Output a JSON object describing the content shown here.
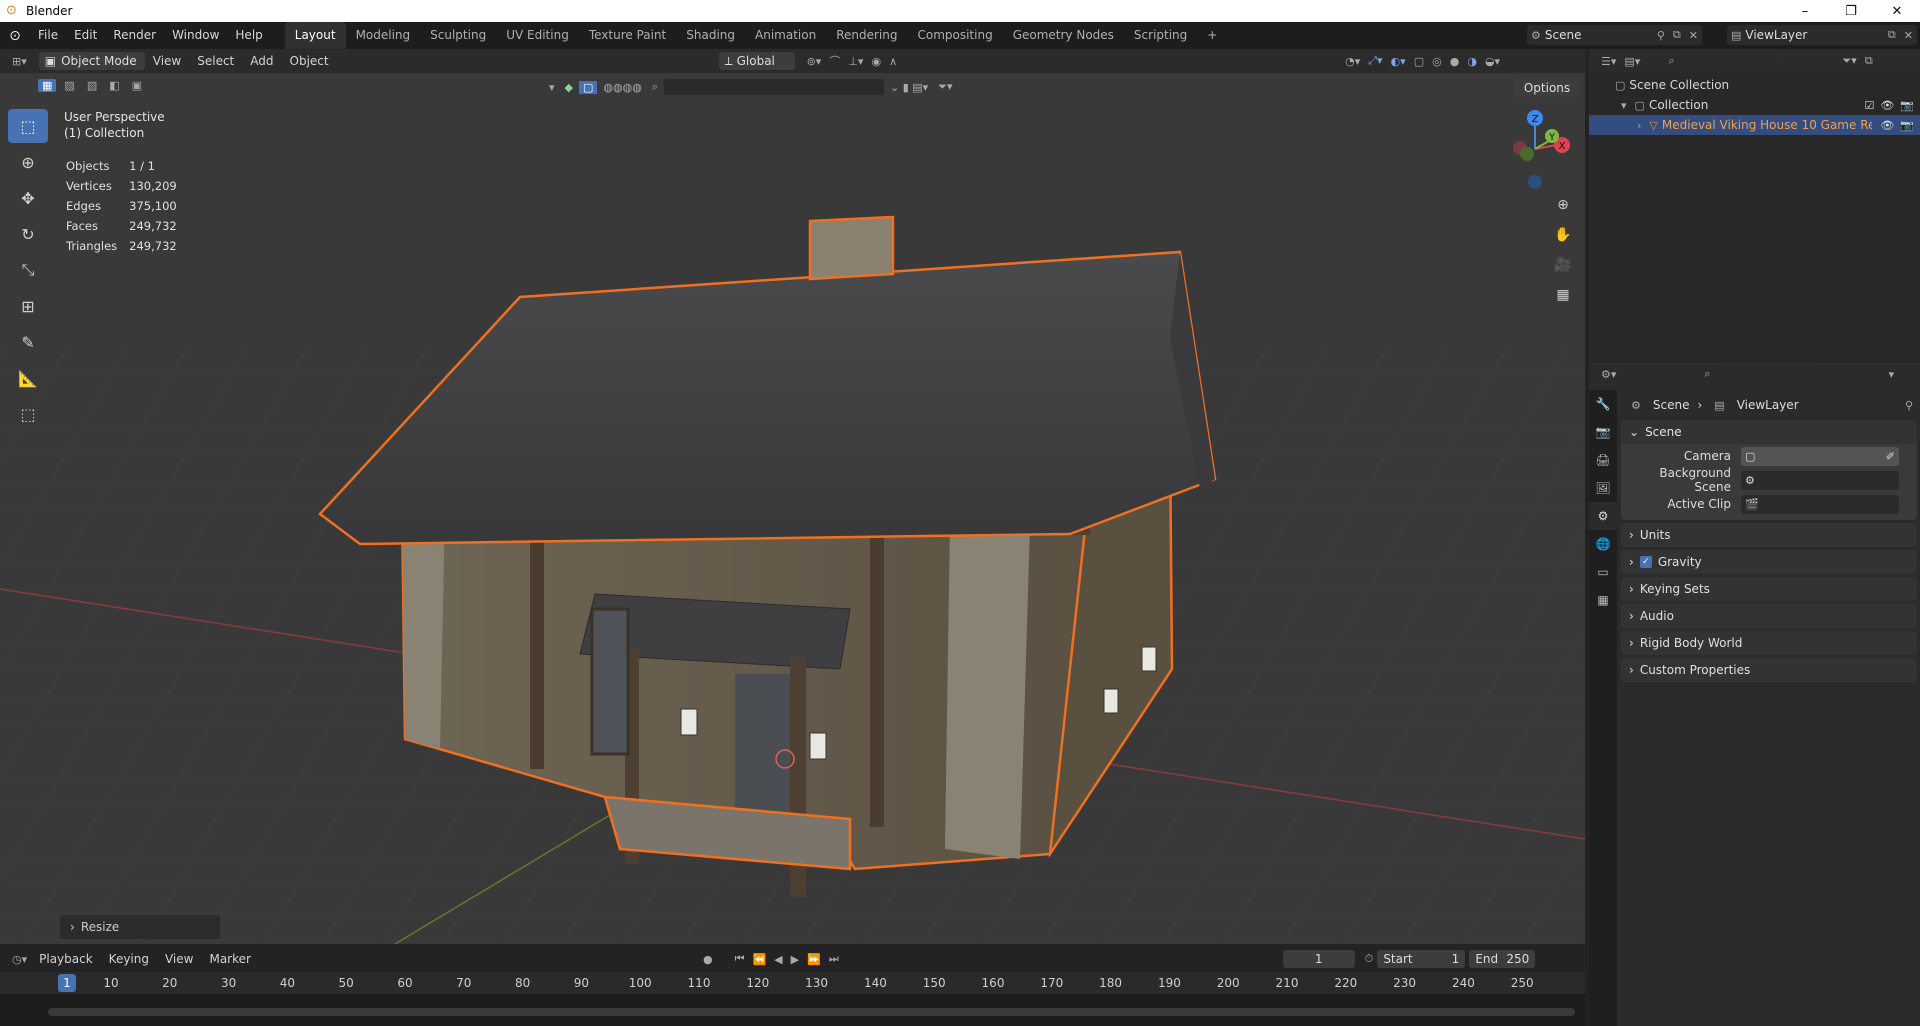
{
  "window": {
    "title": "Blender",
    "controls": [
      "–",
      "❐",
      "✕"
    ]
  },
  "topbar": {
    "menus": [
      "File",
      "Edit",
      "Render",
      "Window",
      "Help"
    ],
    "workspaces": [
      "Layout",
      "Modeling",
      "Sculpting",
      "UV Editing",
      "Texture Paint",
      "Shading",
      "Animation",
      "Rendering",
      "Compositing",
      "Geometry Nodes",
      "Scripting"
    ],
    "add_tab": "+",
    "scene_name": "Scene",
    "view_layer": "ViewLayer"
  },
  "viewport": {
    "mode": "Object Mode",
    "menus": [
      "View",
      "Select",
      "Add",
      "Object"
    ],
    "orientation": "Global",
    "options_label": "Options",
    "perspective": "User Perspective",
    "collection": "(1) Collection",
    "stats": [
      {
        "label": "Objects",
        "value": "1 / 1"
      },
      {
        "label": "Vertices",
        "value": "130,209"
      },
      {
        "label": "Edges",
        "value": "375,100"
      },
      {
        "label": "Faces",
        "value": "249,732"
      },
      {
        "label": "Triangles",
        "value": "249,732"
      }
    ],
    "last_op": "Resize",
    "gizmo_axes": {
      "z": "Z",
      "y": "Y",
      "x": "X"
    },
    "colors": {
      "accent": "#4772b3",
      "outline": "#f07020",
      "axis_x": "#e04050",
      "axis_y": "#7fb83c",
      "axis_z": "#3d8be8"
    }
  },
  "outliner": {
    "root": "Scene Collection",
    "collection": "Collection",
    "object": "Medieval Viking House 10 Game Re"
  },
  "properties": {
    "breadcrumb": {
      "scene": "Scene",
      "view_layer": "ViewLayer"
    },
    "scene_panel": {
      "title": "Scene",
      "fields": [
        {
          "label": "Camera"
        },
        {
          "label": "Background Scene"
        },
        {
          "label": "Active Clip"
        }
      ]
    },
    "panels": [
      "Units",
      "Gravity",
      "Keying Sets",
      "Audio",
      "Rigid Body World",
      "Custom Properties"
    ]
  },
  "timeline": {
    "menus": [
      "Playback",
      "Keying",
      "View",
      "Marker"
    ],
    "current_frame": "1",
    "start_label": "Start",
    "start": "1",
    "end_label": "End",
    "end": "250",
    "ruler_labels": [
      "1",
      "10",
      "20",
      "30",
      "40",
      "50",
      "60",
      "70",
      "80",
      "90",
      "100",
      "110",
      "120",
      "130",
      "140",
      "150",
      "160",
      "170",
      "180",
      "190",
      "200",
      "210",
      "220",
      "230",
      "240",
      "250"
    ]
  }
}
